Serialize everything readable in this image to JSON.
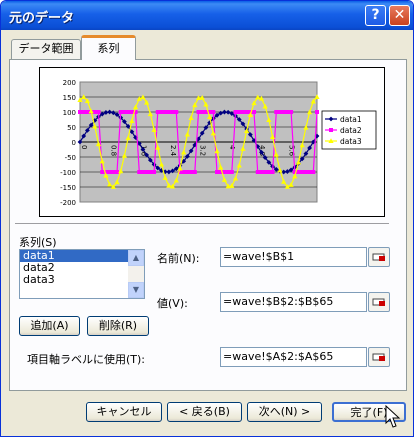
{
  "window": {
    "title": "元のデータ",
    "help_glyph": "?",
    "close_glyph": "✕"
  },
  "tabs": [
    {
      "label": "データ範囲"
    },
    {
      "label": "系列"
    }
  ],
  "chart_data": {
    "type": "line",
    "ylim": [
      -200,
      200
    ],
    "y_ticks": [
      "200",
      "150",
      "100",
      "50",
      "0",
      "-50",
      "-100",
      "-150",
      "-200"
    ],
    "x_tick_labels": [
      "0",
      "0.8",
      "1.6",
      "2.4",
      "3.2",
      "4",
      "4.8",
      "5.6"
    ],
    "x_range": [
      0,
      6.4
    ],
    "plot_background": "#c0c0c0",
    "grid": true,
    "legend_position": "right",
    "series": [
      {
        "name": "data1",
        "color": "#000080",
        "marker": "diamond",
        "amplitude": 100,
        "period": 3.15,
        "phase": 0,
        "step": 0.1
      },
      {
        "name": "data2",
        "color": "#ff00ff",
        "marker": "square",
        "amplitude": 100,
        "period": 1.05,
        "step": 0.1,
        "kind": "square"
      },
      {
        "name": "data3",
        "color": "#ffff00",
        "marker": "triangle",
        "amplitude": 150,
        "period": 1.58,
        "phase": 1.2,
        "step": 0.1
      }
    ]
  },
  "series_section": {
    "label": "系列(S)",
    "items": [
      "data1",
      "data2",
      "data3"
    ],
    "selected_index": 0,
    "add_button": "追加(A)",
    "delete_button": "削除(R)"
  },
  "fields": {
    "name_label": "名前(N):",
    "name_value": "=wave!$B$1",
    "values_label": "値(V):",
    "values_value": "=wave!$B$2:$B$65",
    "category_label": "項目軸ラベルに使用(T):",
    "category_value": "=wave!$A$2:$A$65"
  },
  "footer": {
    "cancel_button": "キャンセル",
    "back_button": "< 戻る(B)",
    "next_button": "次へ(N) >",
    "finish_button": "完了(F)"
  }
}
